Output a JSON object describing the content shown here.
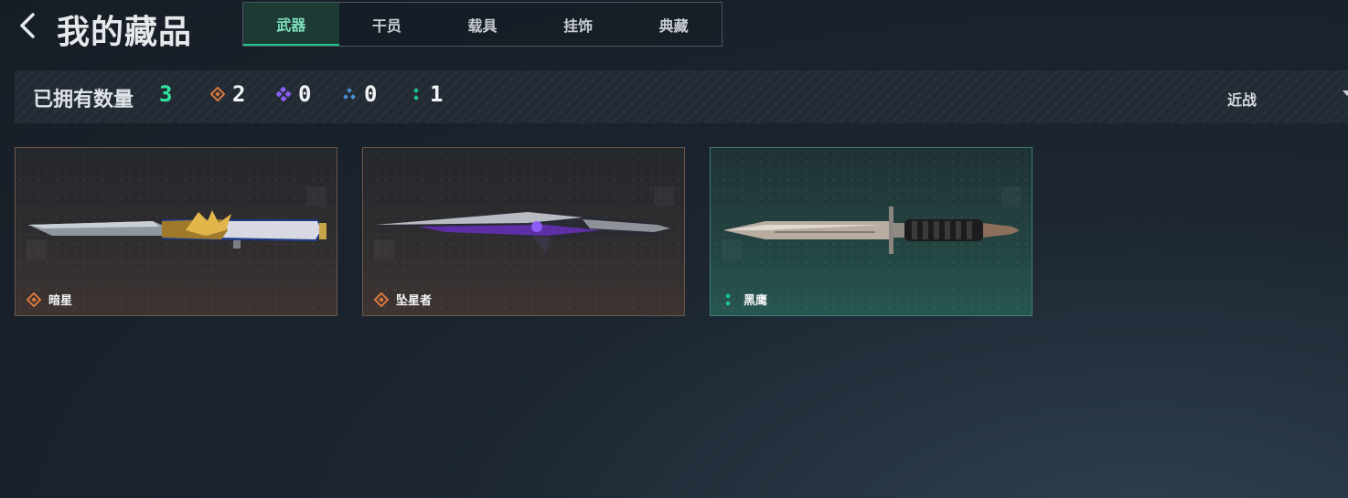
{
  "header": {
    "title": "我的藏品",
    "tabs": [
      {
        "label": "武器",
        "active": true
      },
      {
        "label": "干员",
        "active": false
      },
      {
        "label": "载具",
        "active": false
      },
      {
        "label": "挂饰",
        "active": false
      },
      {
        "label": "典藏",
        "active": false
      }
    ]
  },
  "stats": {
    "owned_label": "已拥有数量",
    "owned_count": "3",
    "rarities": [
      {
        "icon": "orange-rarity-icon",
        "color": "#d9773d",
        "count": "2"
      },
      {
        "icon": "purple-rarity-icon",
        "color": "#8b5cf6",
        "count": "0"
      },
      {
        "icon": "blue-rarity-icon",
        "color": "#4a90d9",
        "count": "0"
      },
      {
        "icon": "green-rarity-icon",
        "color": "#21c48d",
        "count": "1"
      }
    ],
    "filter_label": "近战"
  },
  "items": [
    {
      "name": "暗星",
      "rarity": "orange",
      "icon": "knife-gold-icon"
    },
    {
      "name": "坠星者",
      "rarity": "orange",
      "icon": "knife-purple-icon"
    },
    {
      "name": "黑鹰",
      "rarity": "green",
      "icon": "combat-knife-icon"
    }
  ],
  "colors": {
    "accent_green": "#2ee59d",
    "orange": "#d9773d",
    "purple": "#8b5cf6",
    "blue": "#4a90d9",
    "green": "#21c48d"
  }
}
